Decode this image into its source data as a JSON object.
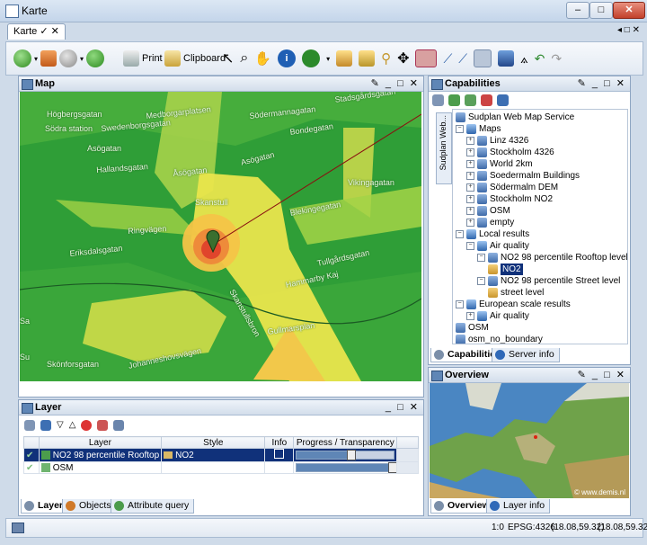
{
  "window": {
    "title": "Karte",
    "controls": {
      "minimize": "–",
      "maximize": "□",
      "close": "✕"
    }
  },
  "tabs": [
    {
      "label": "Karte ✓ ✕"
    }
  ],
  "tab_controls": "◂ □ ✕",
  "toolbar": {
    "print_label": "Print",
    "clipboard_label": "Clipboard"
  },
  "map_panel": {
    "title": "Map",
    "controls": "✎ _ □ ✕",
    "streets": [
      "Stadsgårdsgatan",
      "Högbergsgatan",
      "Medborgarplatsen",
      "Södermannagatan",
      "Södra station",
      "Swedenborgsgatan",
      "Bondegatan",
      "Asögatan",
      "Hallandsgatan",
      "Asögatan",
      "Åsögatan",
      "Vikingagatan",
      "Skanstull",
      "Blekingegatan",
      "Ringvägen",
      "Eriksdalsgatan",
      "Tullgårdsgatan",
      "Hammarby Kaj",
      "Skanstullsbron",
      "Gullmarsplan",
      "Skönforsgatan",
      "Johanneshovsvägen",
      "Sa",
      "Su"
    ]
  },
  "capabilities_panel": {
    "title": "Capabilities",
    "controls": "✎ _ □ ✕",
    "side_tab": "Sudplan Web...",
    "tree": [
      {
        "label": "Sudplan Web Map Service",
        "depth": 0,
        "expander": "",
        "icon": "server-icon"
      },
      {
        "label": "Maps",
        "depth": 0,
        "expander": "−",
        "icon": "folder-icon"
      },
      {
        "label": "Linz 4326",
        "depth": 1,
        "expander": "+",
        "icon": "layer-icon"
      },
      {
        "label": "Stockholm 4326",
        "depth": 1,
        "expander": "+",
        "icon": "layer-icon"
      },
      {
        "label": "World 2km",
        "depth": 1,
        "expander": "+",
        "icon": "layer-icon"
      },
      {
        "label": "Soedermalm Buildings",
        "depth": 1,
        "expander": "+",
        "icon": "layer-icon"
      },
      {
        "label": "Södermalm DEM",
        "depth": 1,
        "expander": "+",
        "icon": "layer-icon"
      },
      {
        "label": "Stockholm NO2",
        "depth": 1,
        "expander": "+",
        "icon": "layer-icon"
      },
      {
        "label": "OSM",
        "depth": 1,
        "expander": "+",
        "icon": "layer-icon"
      },
      {
        "label": "empty",
        "depth": 1,
        "expander": "+",
        "icon": "layer-icon"
      },
      {
        "label": "Local results",
        "depth": 0,
        "expander": "−",
        "icon": "folder-icon"
      },
      {
        "label": "Air quality",
        "depth": 1,
        "expander": "−",
        "icon": "folder-icon"
      },
      {
        "label": "NO2 98 percentile Rooftop level",
        "depth": 2,
        "expander": "−",
        "icon": "layer-icon"
      },
      {
        "label": "NO2",
        "depth": 3,
        "expander": "",
        "icon": "style-icon",
        "selected": true
      },
      {
        "label": "NO2 98 percentile Street level",
        "depth": 2,
        "expander": "−",
        "icon": "layer-icon"
      },
      {
        "label": "street level",
        "depth": 3,
        "expander": "",
        "icon": "style-icon"
      },
      {
        "label": "European scale results",
        "depth": 0,
        "expander": "−",
        "icon": "folder-icon"
      },
      {
        "label": "Air quality",
        "depth": 1,
        "expander": "+",
        "icon": "folder-icon"
      },
      {
        "label": "OSM",
        "depth": 0,
        "expander": "",
        "icon": "layer-icon"
      },
      {
        "label": "osm_no_boundary",
        "depth": 0,
        "expander": "",
        "icon": "layer-icon"
      }
    ],
    "bottom_tabs": [
      {
        "label": "Capabilities"
      },
      {
        "label": "Server info"
      }
    ]
  },
  "overview_panel": {
    "title": "Overview",
    "controls": "✎ _ □ ✕",
    "credit": "© www.demis.nl",
    "bottom_tabs": [
      {
        "label": "Overview"
      },
      {
        "label": "Layer info"
      }
    ]
  },
  "layer_panel": {
    "title": "Layer",
    "controls": "_ □ ✕",
    "columns": [
      "Layer",
      "Style",
      "Info",
      "Progress / Transparency"
    ],
    "rows": [
      {
        "layer": "NO2 98 percentile Rooftop",
        "style": "NO2",
        "info_checked": false,
        "progress": 0.55,
        "selected": true
      },
      {
        "layer": "OSM",
        "style": "",
        "info_checked": null,
        "progress": 0.97,
        "selected": false
      }
    ],
    "bottom_tabs": [
      {
        "label": "Layer"
      },
      {
        "label": "Objects"
      },
      {
        "label": "Attribute query"
      }
    ]
  },
  "statusbar": {
    "scale": "1:0",
    "crs": "EPSG:4326",
    "coord1": "(18.08,59.32)",
    "coord2": "(18.08,59.32)"
  },
  "colors": {
    "accent": "#10317a",
    "map_green": "#2f9e37",
    "map_yellow": "#f0ea4e",
    "map_red": "#e0452c"
  }
}
